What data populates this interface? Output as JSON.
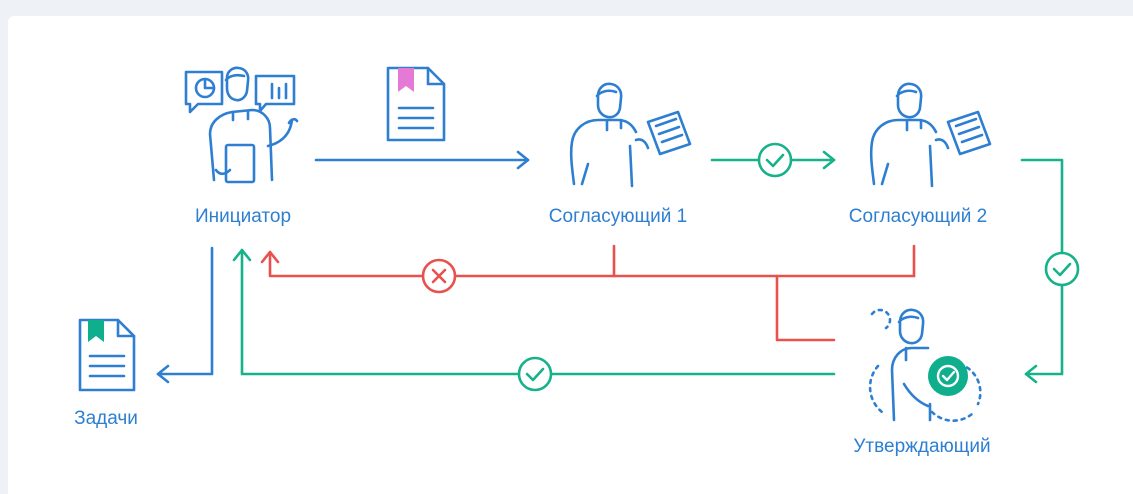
{
  "nodes": {
    "initiator": "Инициатор",
    "approver1": "Согласующий 1",
    "approver2": "Согласующий 2",
    "final_approver": "Утверждающий",
    "tasks": "Задачи"
  },
  "colors": {
    "blue": "#2e7fd1",
    "green": "#17b28a",
    "red": "#e9514f",
    "pink": "#e57ad6",
    "teal_badge": "#0fae8c"
  },
  "icons": {
    "document": "document-icon",
    "approve": "check-circle-icon",
    "reject": "x-circle-icon",
    "person": "person-icon"
  }
}
